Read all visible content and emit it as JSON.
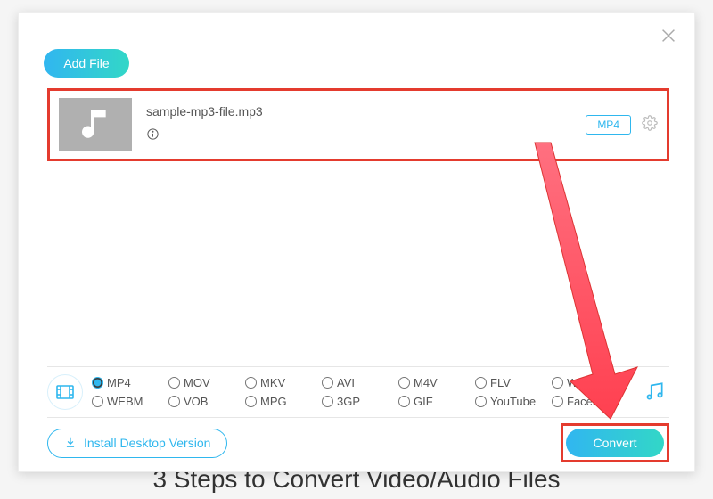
{
  "bg_text": "3 Steps to Convert Video/Audio Files",
  "buttons": {
    "add_file": "Add File",
    "install_desktop": "Install Desktop Version",
    "convert": "Convert"
  },
  "file_item": {
    "name": "sample-mp3-file.mp3",
    "output_format": "MP4"
  },
  "format_options": {
    "row1": [
      "MP4",
      "MOV",
      "MKV",
      "AVI",
      "M4V",
      "FLV",
      "WMV"
    ],
    "row2": [
      "WEBM",
      "VOB",
      "MPG",
      "3GP",
      "GIF",
      "YouTube",
      "Facebook"
    ],
    "selected": "MP4"
  },
  "colors": {
    "accent": "#2fb7ee",
    "highlight_box": "#e43b2e",
    "arrow": "#ff5a6a"
  }
}
